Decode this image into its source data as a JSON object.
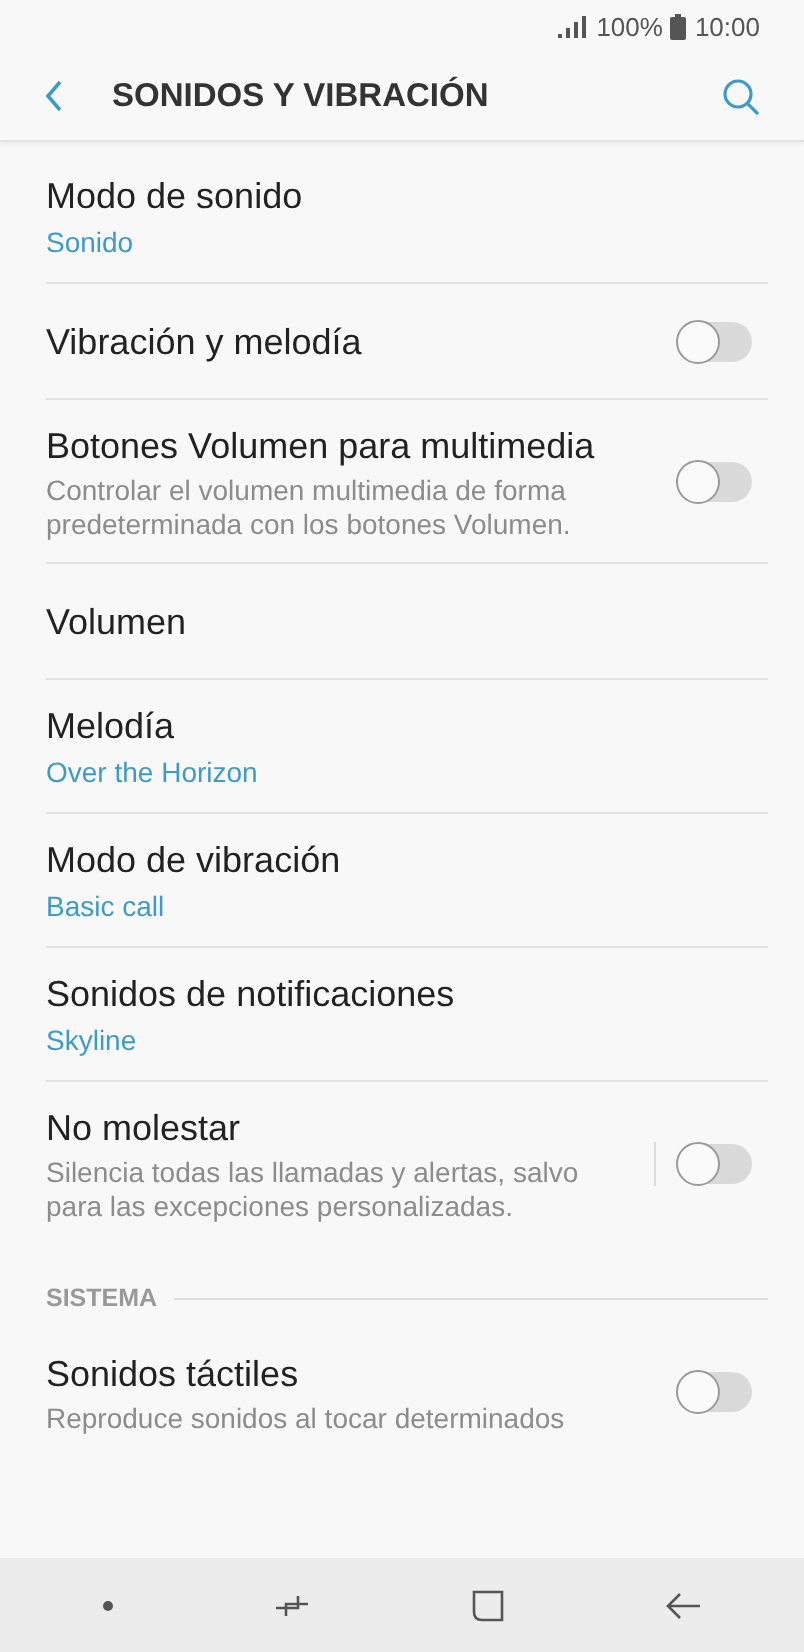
{
  "status_bar": {
    "battery": "100%",
    "time": "10:00"
  },
  "header": {
    "title": "SONIDOS Y VIBRACIÓN"
  },
  "sections": [
    {
      "items": [
        {
          "kind": "item",
          "title": "Modo de sonido",
          "value": "Sonido"
        },
        {
          "kind": "switch",
          "title": "Vibración y melodía",
          "on": false
        },
        {
          "kind": "switch",
          "title": "Botones Volumen para multimedia",
          "summary": "Controlar el volumen multimedia de forma predeterminada con los botones Volumen.",
          "on": false
        },
        {
          "kind": "item",
          "title": "Volumen"
        },
        {
          "kind": "item",
          "title": "Melodía",
          "value": "Over the Horizon"
        },
        {
          "kind": "item",
          "title": "Modo de vibración",
          "value": "Basic call"
        },
        {
          "kind": "item",
          "title": "Sonidos de notificaciones",
          "value": "Skyline"
        },
        {
          "kind": "split-switch",
          "title": "No molestar",
          "summary": "Silencia todas las llamadas y alertas, salvo para las excepciones personalizadas.",
          "on": false
        }
      ]
    },
    {
      "header": "SISTEMA",
      "items": [
        {
          "kind": "switch",
          "title": "Sonidos táctiles",
          "summary": "Reproduce sonidos al tocar determinados",
          "on": false
        }
      ]
    }
  ]
}
